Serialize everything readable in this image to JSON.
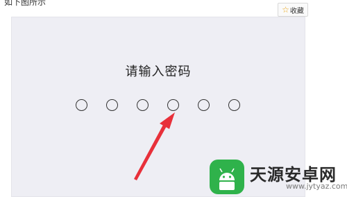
{
  "caption": "如下图所示",
  "collect_button": {
    "icon": "star-outline-icon",
    "label": "收藏"
  },
  "screen": {
    "title": "请输入密码",
    "pin_dot_count": 6,
    "pin_filled": 0
  },
  "watermark": {
    "title": "天源安卓网",
    "url": "www.jytyaz.com",
    "brand_color": "#2fb24b"
  },
  "annotation_color": "#e8303a"
}
